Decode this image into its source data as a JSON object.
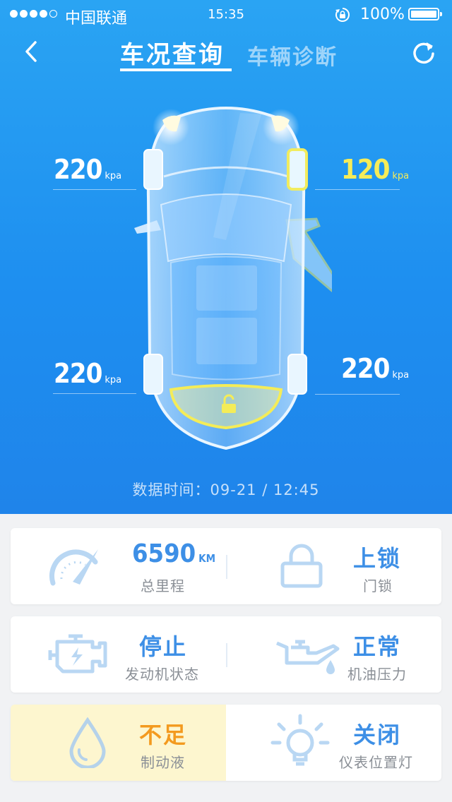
{
  "status_bar": {
    "carrier": "中国联通",
    "time": "15:35",
    "battery": "100%"
  },
  "nav": {
    "tab_active": "车况查询",
    "tab_inactive": "车辆诊断"
  },
  "tire_pressure": {
    "front_left": "220",
    "front_right": "120",
    "rear_left": "220",
    "rear_right": "220",
    "unit": "kpa",
    "warning_color": "#f6ec58"
  },
  "data_time": "数据时间：09-21 / 12:45",
  "cards": {
    "mileage": {
      "value": "6590",
      "unit": "KM",
      "label": "总里程"
    },
    "door_lock": {
      "value": "上锁",
      "label": "门锁"
    },
    "engine": {
      "value": "停止",
      "label": "发动机状态"
    },
    "oil_pressure": {
      "value": "正常",
      "label": "机油压力"
    },
    "brake_fluid": {
      "value": "不足",
      "label": "制动液"
    },
    "position_light": {
      "value": "关闭",
      "label": "仪表位置灯"
    }
  },
  "colors": {
    "accent": "#3d8fe6",
    "warning": "#f39a1f",
    "warning_bg": "#fdf6cf",
    "hero_blue": "#2196f3"
  }
}
